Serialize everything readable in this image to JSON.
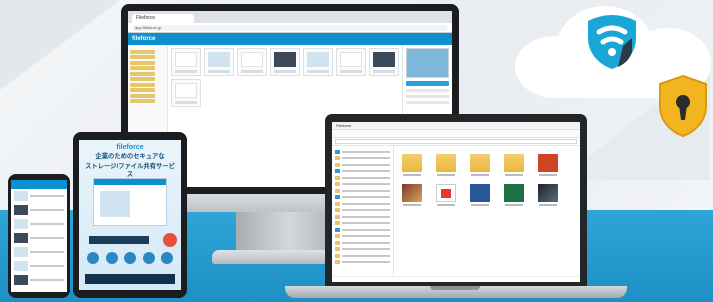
{
  "monitor": {
    "browser_tab": "Fileforce",
    "address": "app.fileforce.jp",
    "app_logo": "fileforce"
  },
  "explorer": {
    "window_title": "Fileforce"
  },
  "tablet": {
    "logo": "fileforce",
    "headline_1": "企業のためのセキュアな",
    "headline_2": "ストレージ/ファイル共有サービス"
  },
  "colors": {
    "accent": "#0e8fd0",
    "band": "#2ea6d6",
    "shield": "#f2b51f"
  },
  "icons": [
    "fileforce-cloud-logo",
    "lock-shield-icon"
  ]
}
